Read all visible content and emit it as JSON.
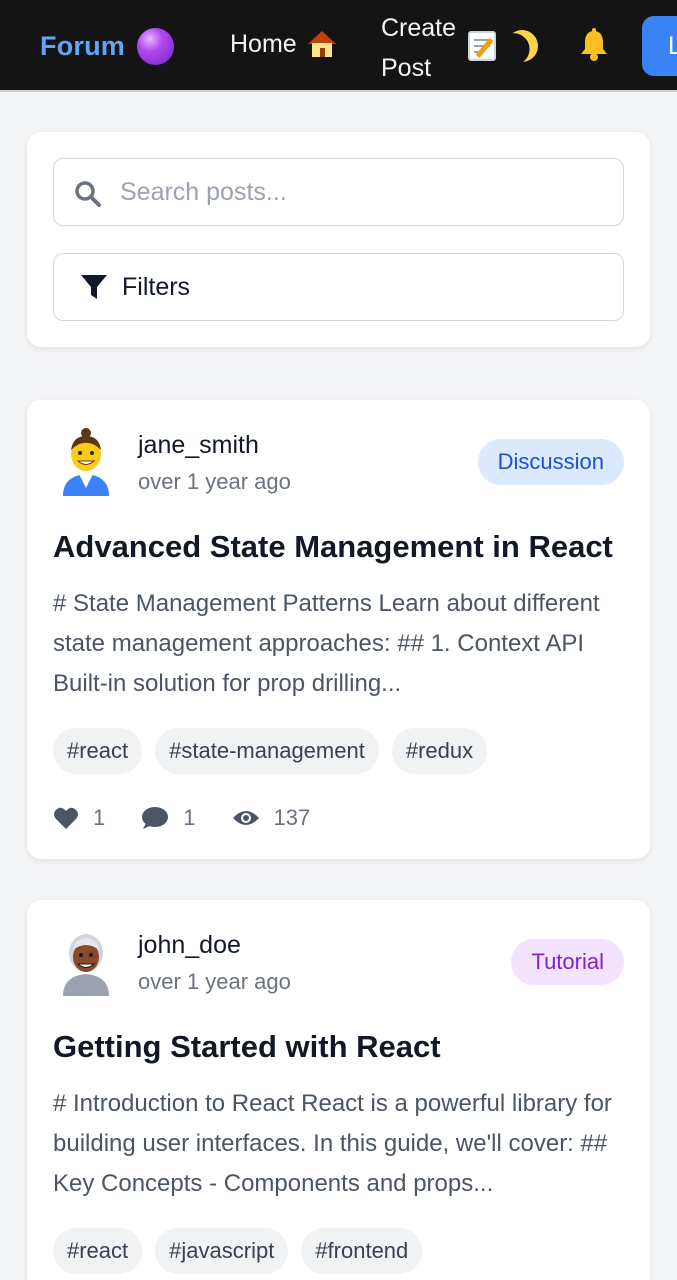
{
  "nav": {
    "brand": "Forum",
    "home_label": "Home",
    "create_line1": "Create",
    "create_line2": "Post",
    "login_label": "Login"
  },
  "search": {
    "placeholder": "Search posts...",
    "value": "",
    "filters_label": "Filters"
  },
  "posts": [
    {
      "author": "jane_smith",
      "time": "over 1 year ago",
      "category": "Discussion",
      "title": "Advanced State Management in React",
      "excerpt": "# State Management Patterns Learn about different state management approaches: ## 1. Context API Built-in solution for prop drilling...",
      "tags": [
        "#react",
        "#state-management",
        "#redux"
      ],
      "likes": "1",
      "comments": "1",
      "views": "137",
      "avatar_icon": "woman-avatar-icon"
    },
    {
      "author": "john_doe",
      "time": "over 1 year ago",
      "category": "Tutorial",
      "title": "Getting Started with React",
      "excerpt": "# Introduction to React React is a powerful library for building user interfaces. In this guide, we'll cover: ## Key Concepts - Components and props...",
      "tags": [
        "#react",
        "#javascript",
        "#frontend"
      ],
      "avatar_icon": "man-avatar-icon"
    }
  ],
  "colors": {
    "nav_bg": "#141414",
    "brand": "#60a5fa",
    "accent": "#3b82f6",
    "discussion_badge_bg": "#dbeafe",
    "discussion_badge_text": "#1d4ed8",
    "tutorial_badge_bg": "#f3e3ff",
    "tutorial_badge_text": "#7e22ce"
  }
}
